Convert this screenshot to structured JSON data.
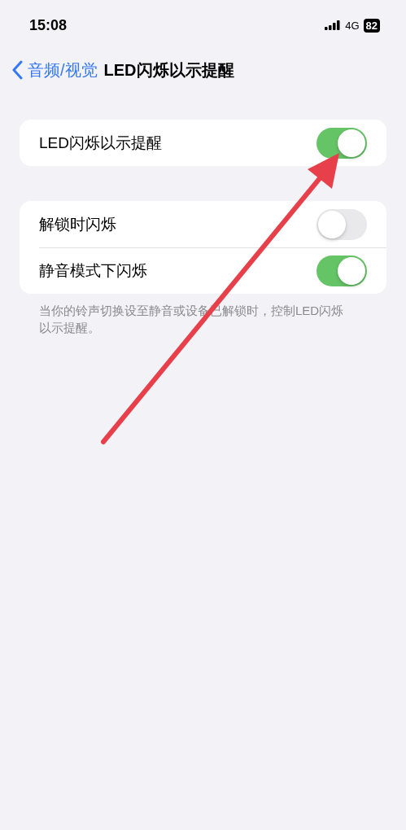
{
  "status_bar": {
    "time": "15:08",
    "network": "4G",
    "battery": "82"
  },
  "nav": {
    "back": "音频/视觉",
    "title": "LED闪烁以示提醒"
  },
  "groups": [
    {
      "rows": [
        {
          "label": "LED闪烁以示提醒",
          "on": true
        }
      ]
    },
    {
      "rows": [
        {
          "label": "解锁时闪烁",
          "on": false
        },
        {
          "label": "静音模式下闪烁",
          "on": true
        }
      ],
      "footer": "当你的铃声切换设至静音或设备已解锁时，控制LED闪烁以示提醒。"
    }
  ]
}
